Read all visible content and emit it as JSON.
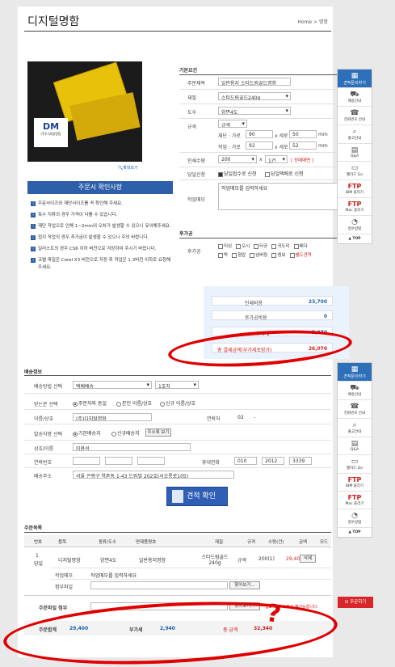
{
  "page": {
    "title": "디지털명함",
    "breadcrumb": "Home > 명함"
  },
  "product": {
    "zoom_label": "확대보기",
    "logo_text": "(주)디지털명함"
  },
  "notice": {
    "title": "주문시 확인사항",
    "items": [
      "주문사이즈와 재단사이즈를 꼭 확인해 주세요.",
      "특수 지류의 경우 가격이 다를 수 있습니다.",
      "재단 작업으로 인해 1~2mm의 오차가 발생할 수 있으니 유의해주세요.",
      "접지 작업의 경우 추가금이 발생할 수 있으니 주의 바랍니다.",
      "일러스트의 경우 CS6 이하 버전으로 저장하여 주시기 바랍니다.",
      "코렐 파일은 Corel X3 버전으로 저장 후 작업은 1.3버전 이하로 요청해 주세요."
    ]
  },
  "basic": {
    "section_title": "기본요건",
    "order_title_label": "주문제목",
    "order_title_value": "일반용지 스타드림골드명함",
    "paper_label": "재질",
    "paper_value": "스타드림골드240g",
    "color_label": "도수",
    "color_value": "양면4도",
    "size_label": "규격",
    "size_value": "규격",
    "cut_label": "재단 : 가로",
    "cut_w": "90",
    "cut_x": "x 세로",
    "cut_h": "50",
    "cut_unit": "mm",
    "work_label": "작업 : 가로",
    "work_w": "92",
    "work_x": "x 세로",
    "work_h": "52",
    "work_unit": "mm",
    "qty_label": "인쇄수량",
    "qty_value": "200",
    "qty_x": "x",
    "qty_sets": "1건",
    "qty_hint": "[ 정매매면 ]",
    "delivery_label": "당일신청",
    "delivery_opt1": "당일접수로 신청",
    "delivery_opt2": "당일택배로 신청",
    "memo_label": "작업메모",
    "memo_value": "작업메모를 입력하세요"
  },
  "options": {
    "section_title": "후가공",
    "row_label": "후가공",
    "row1": [
      "미싱",
      "오시",
      "타공",
      "귀도리",
      "배다"
    ],
    "row2": [
      "박",
      "형압",
      "넘버링",
      "엠보",
      "별도견적"
    ]
  },
  "summary": {
    "print_label": "인쇄비용",
    "print_value": "23,700",
    "post_label": "후가공비용",
    "post_value": "0",
    "vat_label": "부가세",
    "vat_value": "2,370",
    "total_label": "총 결제금액(부가세포함가)",
    "total_value": "26,070"
  },
  "shipping": {
    "section_title": "배송정보",
    "method_label": "배송방법 선택",
    "method_value": "택배배송",
    "method_sub": "1호차",
    "receiver_label": "받는분 선택",
    "recv_opt1": "주문자와 동일",
    "recv_opt2": "본인 이름/상호",
    "recv_opt3": "신규 이름/상호",
    "name_label": "이름/상호",
    "name_value": "(주)디지털명함",
    "phone_label": "연락처",
    "phone_value": "02",
    "phone_dash": "-",
    "sender_label": "발송자명 선택",
    "send_opt1": "기본배송지",
    "send_opt2": "신규배송지",
    "addr_btn": "주소록 보기",
    "company_label": "상호/이름",
    "company_value": "미용석",
    "tel_label": "연락번호",
    "mobile_label": "휴대전화",
    "mobile_1": "010",
    "mobile_2": "2012",
    "mobile_3": "3339",
    "address_label": "배송주소",
    "address_value": "서울 은평구 역촌동 1-43 드림빌 202호(서오릉로105)"
  },
  "estimate_button": "견적 확인",
  "order_list": {
    "section_title": "주문목록",
    "headers": [
      "번호",
      "품목",
      "종류/도수",
      "면제품명호",
      "재질",
      "규격",
      "수량(건)",
      "금액",
      "모드"
    ],
    "row": {
      "no": "1",
      "no_sub": "당일",
      "item": "디지털명함",
      "type": "양면4도",
      "name": "일반용지명함",
      "paper": "스타드림골드 240g",
      "size": "규격",
      "qty": "200(1)",
      "amount": "29,400",
      "delete": "삭제"
    },
    "work_label": "작업메모",
    "work_value": "작업메모를 입력하세요",
    "attach_label": "첨부파일",
    "browse": "찾아보기...",
    "attach_all_label": "주문파일 첨부",
    "browse2": "찾아보기...",
    "attach_note": "업로드 후 수정이 불가능합니다."
  },
  "totals": {
    "order_label": "주문합계",
    "order_value": "29,400",
    "vat_label": "부가세",
    "vat_value": "2,940",
    "total_label": "총 금액",
    "total_value": "32,340"
  },
  "sidebar": {
    "head": "견적문의하기",
    "items": [
      "배송안내",
      "전화번호 안내",
      "출고안내",
      "Q&A",
      "웹하드 Go"
    ],
    "ftp1": "FTP",
    "ftp1_sub": "IBM 올리기",
    "ftp2": "FTP",
    "ftp2_sub": "Mac 올리기",
    "last": "접수방법",
    "top": "TOP",
    "order_btn": "주문하기"
  }
}
